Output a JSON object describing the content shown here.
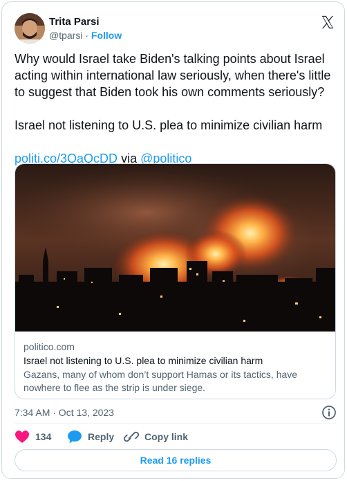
{
  "author": {
    "name": "Trita Parsi",
    "handle": "@tparsi",
    "separator": "·",
    "follow_label": "Follow"
  },
  "tweet": {
    "paragraph_1": "Why would Israel take Biden's talking points about Israel acting within international law seriously, when there's little to suggest that Biden took his own comments seriously?",
    "paragraph_2": "Israel not listening to U.S. plea to minimize civilian harm",
    "link_text": "politi.co/3QaQcDD",
    "via_text": " via ",
    "mention": "@politico"
  },
  "link_card": {
    "domain": "politico.com",
    "title": "Israel not listening to U.S. plea to minimize civilian harm",
    "description": "Gazans, many of whom don’t support Hamas or its tactics, have nowhere to flee as the strip is under siege."
  },
  "timestamp": "7:34 AM · Oct 13, 2023",
  "actions": {
    "likes_count": "134",
    "reply_label": "Reply",
    "copy_link_label": "Copy link"
  },
  "read_replies_label": "Read 16 replies",
  "colors": {
    "accent": "#1d9bf0",
    "like": "#f91880",
    "text": "#0f1419",
    "secondary": "#536471",
    "border": "#cfd9de"
  },
  "icons": [
    "x-logo-icon",
    "info-icon",
    "heart-icon",
    "reply-bubble-icon",
    "link-icon"
  ]
}
